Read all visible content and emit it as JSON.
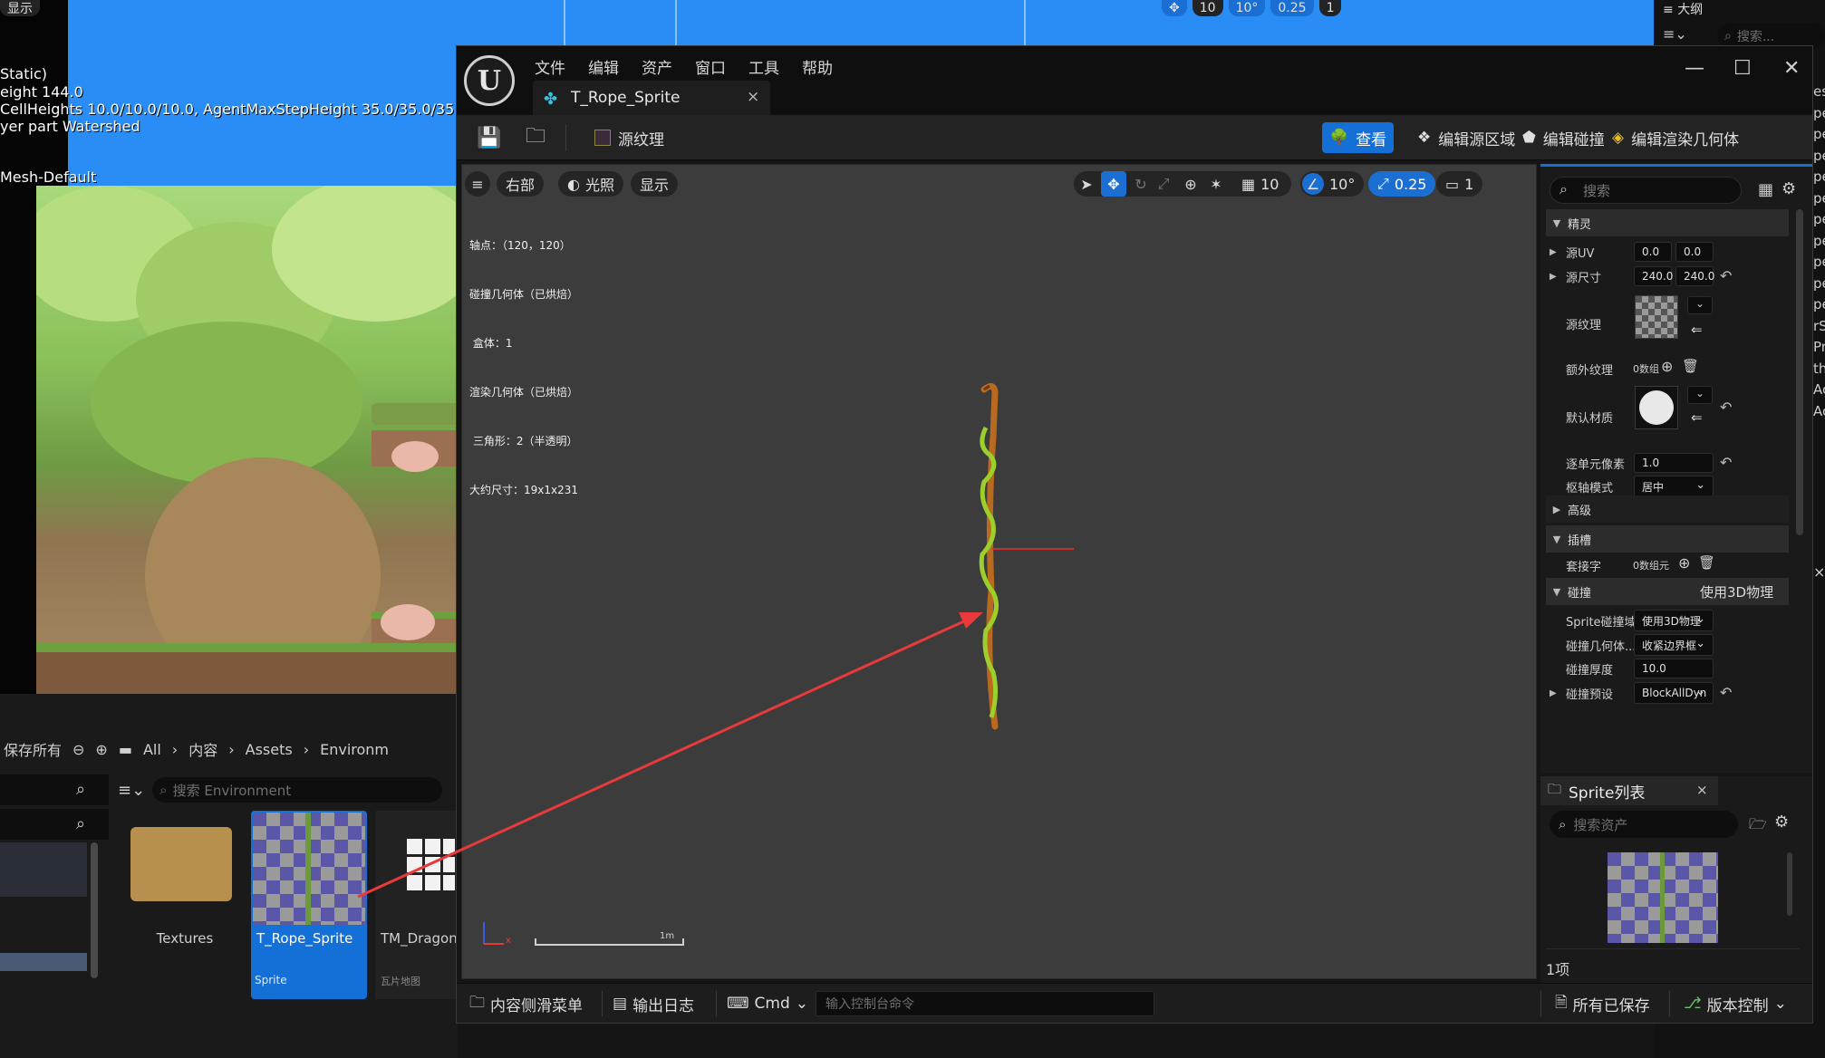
{
  "background": {
    "viewport_toolbar_left": "显示",
    "viewport_toolbar_right": [
      "10",
      "10°",
      "0.25",
      "1"
    ],
    "overlay_lines": [
      "Static)",
      "eight 144.0",
      "CellHeights 10.0/10.0/10.0, AgentMaxStepHeight 35.0/35.0/35.0",
      "yer part Watershed",
      "Mesh-Default"
    ],
    "outliner_title": "大纲",
    "outliner_search": "搜索...",
    "outliner_rows": [
      "es",
      "pe",
      "pe",
      "pe",
      "pe",
      "pe",
      "pe",
      "pe",
      "pe",
      "pe",
      "pe",
      "rS",
      "Pro",
      "th",
      "Ac",
      "Ac"
    ],
    "content_browser": {
      "save_all": "保存所有",
      "path": [
        "All",
        "内容",
        "Assets",
        "Environm"
      ],
      "search_placeholder": "搜索 Environment",
      "tiles": [
        {
          "label": "Textures",
          "type": ""
        },
        {
          "label": "T_Rope_Sprite",
          "type": "Sprite"
        },
        {
          "label": "TM_Dragonf",
          "type": "瓦片地图"
        }
      ]
    }
  },
  "window": {
    "menu": [
      "文件",
      "编辑",
      "资产",
      "窗口",
      "工具",
      "帮助"
    ],
    "tab_title": "T_Rope_Sprite",
    "toolbar": {
      "source_texture": "源纹理",
      "view": "查看",
      "edit_source_region": "编辑源区域",
      "edit_collision": "编辑碰撞",
      "edit_render_geometry": "编辑渲染几何体"
    },
    "viewport": {
      "view_mode": "右部",
      "lighting": "光照",
      "show": "显示",
      "grid": "10",
      "angle": "10°",
      "scale": "0.25",
      "camera_speed": "1",
      "stats": [
        "轴点：（120，120）",
        "碰撞几何体（已烘焙）",
        " 盒体：1",
        "渲染几何体（已烘焙）",
        " 三角形：2（半透明）",
        "大约尺寸：19x1x231"
      ],
      "scale_label": "1m",
      "axis_x": "x"
    },
    "details": {
      "search_placeholder": "搜索",
      "sections": {
        "sprite": "精灵",
        "advanced": "高级",
        "sockets": "插槽",
        "collision": "碰撞",
        "collision_value": "使用3D物理"
      },
      "rows": {
        "source_uv": {
          "label": "源UV",
          "x": "0.0",
          "y": "0.0"
        },
        "source_size": {
          "label": "源尺寸",
          "x": "240.0",
          "y": "240.0"
        },
        "source_texture": {
          "label": "源纹理"
        },
        "additional_textures": {
          "label": "额外纹理",
          "value": "0数组"
        },
        "default_material": {
          "label": "默认材质"
        },
        "pixels_per_unit": {
          "label": "逐单元像素",
          "value": "1.0"
        },
        "pivot_mode": {
          "label": "枢轴模式",
          "value": "居中"
        },
        "sockets": {
          "label": "套接字",
          "value": "0数组元"
        },
        "sprite_collision_domain": {
          "label": "Sprite碰撞域",
          "value": "使用3D物理"
        },
        "collision_geometry": {
          "label": "碰撞几何体...",
          "value": "收紧边界框"
        },
        "collision_thickness": {
          "label": "碰撞厚度",
          "value": "10.0"
        },
        "collision_preset": {
          "label": "碰撞预设",
          "value": "BlockAllDyn"
        }
      }
    },
    "sprite_list": {
      "tab_title": "Sprite列表",
      "search_placeholder": "搜索资产",
      "count": "1项"
    },
    "status_bar": {
      "content_drawer": "内容侧滑菜单",
      "output_log": "输出日志",
      "cmd": "Cmd",
      "cmd_placeholder": "输入控制台命令",
      "all_saved": "所有已保存",
      "source_control": "版本控制"
    }
  },
  "colors": {
    "accent": "#1470d6",
    "background_viewport": "#2a8cf5",
    "annotation_arrow": "#e83a3a"
  }
}
